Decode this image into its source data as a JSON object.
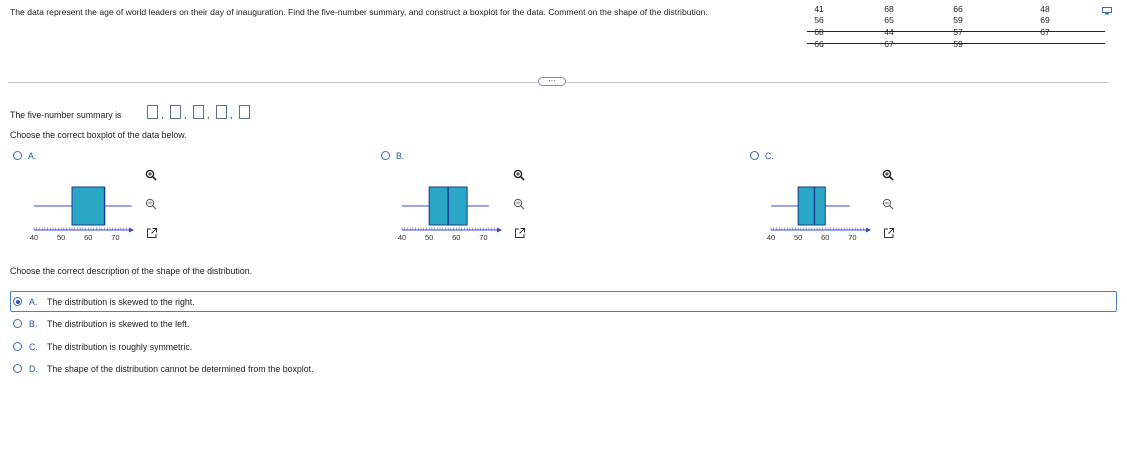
{
  "question": {
    "text": "The data represent the age of world leaders on their day of inauguration. Find the five-number summary, and construct a boxplot for the data. Comment on the shape of the distribution."
  },
  "data_table": {
    "rows": [
      [
        "41",
        "68",
        "66",
        "48"
      ],
      [
        "56",
        "65",
        "59",
        "69"
      ],
      [
        "68",
        "44",
        "57",
        "67"
      ],
      [
        "66",
        "67",
        "59",
        ""
      ]
    ]
  },
  "five_number": {
    "label": "The five-number summary is",
    "separator": ","
  },
  "boxplot_question": {
    "prompt": "Choose the correct boxplot of the data below.",
    "options": [
      {
        "letter": "A.",
        "selected": false,
        "min": 40,
        "q1": 54,
        "median": 66,
        "q3": 66,
        "max": 76
      },
      {
        "letter": "B.",
        "selected": false,
        "min": 40,
        "q1": 50,
        "median": 57,
        "q3": 64,
        "max": 72
      },
      {
        "letter": "C.",
        "selected": false,
        "min": 40,
        "q1": 50,
        "median": 56,
        "q3": 60,
        "max": 69
      }
    ],
    "axis_ticks": [
      "40",
      "50",
      "60",
      "70"
    ],
    "box_color": "#2aa7c4",
    "whisker_color": "#3b47c9"
  },
  "shape_question": {
    "prompt": "Choose the correct description of the shape of the distribution.",
    "options": [
      {
        "letter": "A.",
        "text": "The distribution is skewed to the right.",
        "selected": true
      },
      {
        "letter": "B.",
        "text": "The distribution is skewed to the left.",
        "selected": false
      },
      {
        "letter": "C.",
        "text": "The distribution is roughly symmetric.",
        "selected": false
      },
      {
        "letter": "D.",
        "text": "The shape of the distribution cannot be determined from the boxplot.",
        "selected": false
      }
    ]
  },
  "icons": {
    "zoom_in": "zoom-in-icon",
    "zoom_out": "zoom-out-icon",
    "popout": "popout-icon",
    "more": "more-dots-icon"
  },
  "ui_colors": {
    "accent": "#2a5aa8",
    "selected_border": "#4a7fc9"
  }
}
